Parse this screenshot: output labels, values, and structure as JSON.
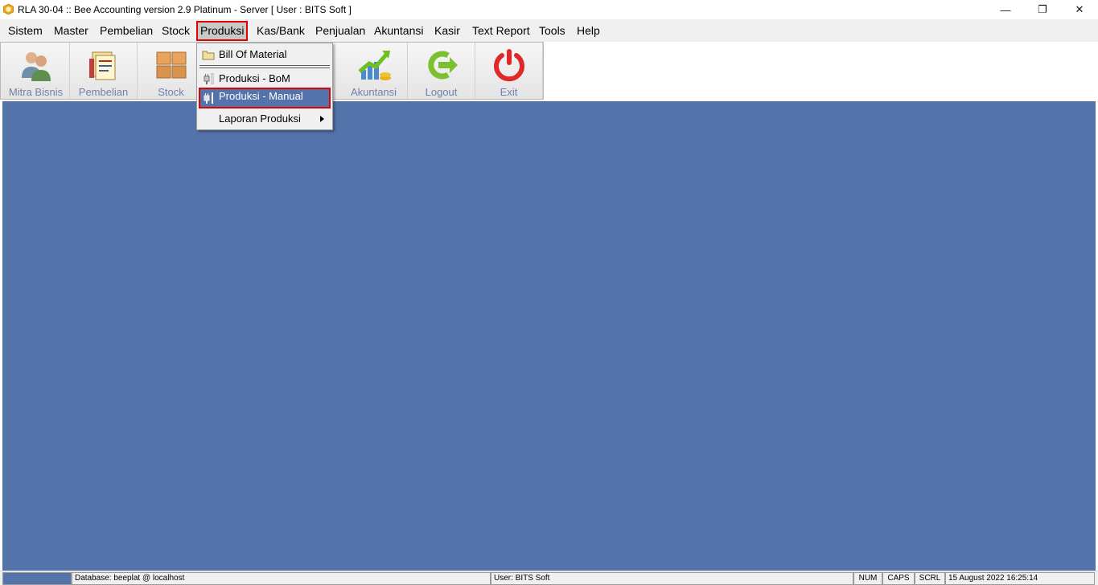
{
  "window": {
    "title": "RLA 30-04 :: Bee Accounting version 2.9 Platinum - Server  [ User : BITS Soft ]",
    "minimize_glyph": "—",
    "restore_glyph": "❐",
    "close_glyph": "✕"
  },
  "menubar": {
    "items": [
      {
        "label": "Sistem",
        "key": "sistem"
      },
      {
        "label": "Master",
        "key": "master"
      },
      {
        "label": "Pembelian",
        "key": "pembelian"
      },
      {
        "label": "Stock",
        "key": "stock"
      },
      {
        "label": "Produksi",
        "key": "produksi",
        "active": true
      },
      {
        "label": "Kas/Bank",
        "key": "kas-bank"
      },
      {
        "label": "Penjualan",
        "key": "penjualan"
      },
      {
        "label": "Akuntansi",
        "key": "akuntansi"
      },
      {
        "label": "Kasir",
        "key": "kasir"
      },
      {
        "label": "Text Report",
        "key": "text-report"
      },
      {
        "label": "Tools",
        "key": "tools"
      },
      {
        "label": "Help",
        "key": "help"
      }
    ]
  },
  "toolbar": {
    "buttons": [
      {
        "label": "Mitra Bisnis",
        "icon": "people-icon"
      },
      {
        "label": "Pembelian",
        "icon": "documents-icon"
      },
      {
        "label": "Stock",
        "icon": "boxes-icon"
      },
      {
        "label": "Akuntansi",
        "icon": "growth-chart-icon"
      },
      {
        "label": "Logout",
        "icon": "logout-arrow-icon"
      },
      {
        "label": "Exit",
        "icon": "power-icon"
      }
    ]
  },
  "dropdown": {
    "items": [
      {
        "label": "Bill Of Material",
        "icon": "folder-icon"
      },
      {
        "label": "Produksi - BoM",
        "icon": "plug-icon"
      },
      {
        "label": "Produksi - Manual",
        "icon": "plug-icon",
        "highlighted": true
      },
      {
        "label": "Laporan Produksi",
        "has_submenu": true
      }
    ]
  },
  "statusbar": {
    "database": "Database: beeplat @ localhost",
    "user": "User: BITS Soft",
    "num": "NUM",
    "caps": "CAPS",
    "scrl": "SCRL",
    "datetime": "15 August 2022  16:25:14"
  },
  "colors": {
    "workspace": "#5473ab",
    "highlight_border": "#e00000",
    "toolbar_label": "#7080a8"
  }
}
